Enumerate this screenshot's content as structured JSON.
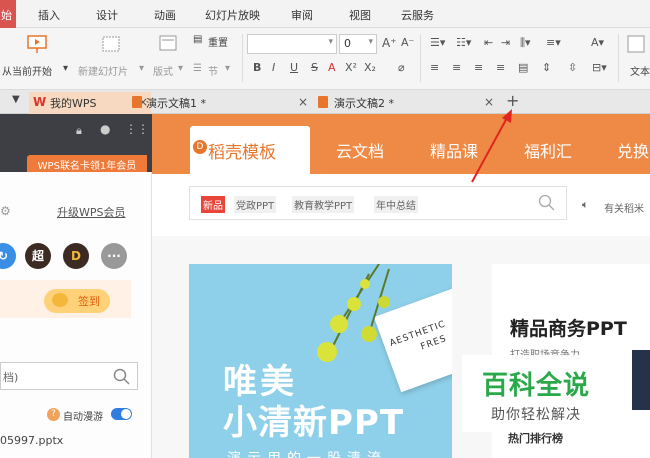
{
  "menubar": {
    "active_tab": "始",
    "items": [
      "插入",
      "设计",
      "动画",
      "幻灯片放映",
      "审阅",
      "视图",
      "云服务"
    ]
  },
  "ribbon": {
    "from_current_label": "从当前开始",
    "new_slide_label": "新建幻灯片",
    "layout_label": "版式",
    "reset_label": "重置",
    "section_label": "节",
    "font_size": "0",
    "format_glyphs": [
      "B",
      "I",
      "U",
      "S",
      "A",
      "X²",
      "X₂"
    ],
    "text_label": "文本"
  },
  "tabs": {
    "mywps": "我的WPS",
    "doc1": "演示文稿1 *",
    "doc2": "演示文稿2 *",
    "close": "×",
    "plus": "+"
  },
  "leftpanel": {
    "promo": "WPS联名卡领1年会员",
    "upgrade": "升级WPS会员",
    "avatar_chao": "超",
    "avatar_d": "D",
    "avatar_more": "···",
    "sign_in": "签到",
    "search_placeholder": "档)",
    "auto_roam": "自动漫游",
    "recent_file": "05997.pptx"
  },
  "main": {
    "tabs": [
      {
        "label": "稻壳模板"
      },
      {
        "label": "云文档"
      },
      {
        "label": "精品课"
      },
      {
        "label": "福利汇"
      },
      {
        "label": "兑换"
      }
    ],
    "search_tags": [
      "新品",
      "党政PPT",
      "教育教学PPT",
      "年中总结"
    ],
    "announcement": "有关稻米"
  },
  "banner": {
    "title1": "唯美",
    "title2": "小清新PPT",
    "title3": "演示用的一股清流",
    "card_line1": "AESTHETIC",
    "card_line2": "FRES"
  },
  "rightcard": {
    "title": "精品商务PPT",
    "subtitle": "打造职场竞争力",
    "hot": "热门排行榜"
  },
  "watermark": {
    "main": "百科全说",
    "sub": "助你轻松解决"
  },
  "colors": {
    "accent_orange": "#ee8a45",
    "active_red": "#d9534f",
    "toggle_blue": "#2f7de1",
    "watermark_green": "#2aa84a"
  }
}
